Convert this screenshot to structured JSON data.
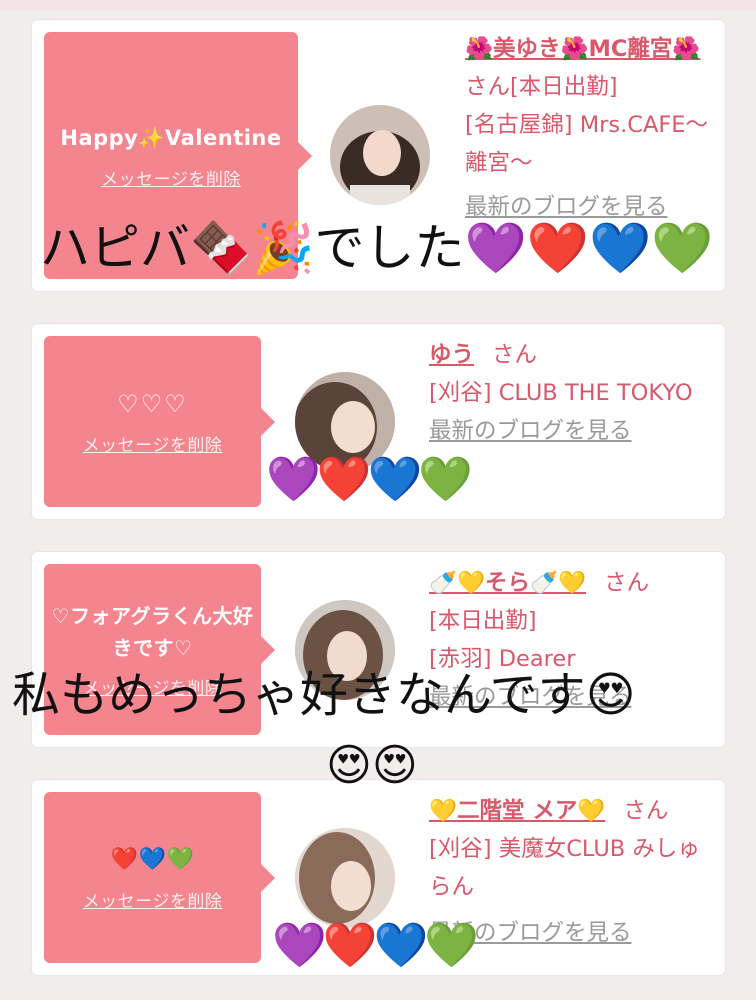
{
  "cards": [
    {
      "message": "Happy✨Valentine",
      "delete_label": "メッセージを削除",
      "name": "🌺美ゆき🌺MC離宮🌺",
      "san": "さん",
      "status": "[本日出勤]",
      "shop": "[名古屋錦] Mrs.CAFE〜離宮〜",
      "blog_label": "最新のブログを見る"
    },
    {
      "message": "♡♡♡",
      "delete_label": "メッセージを削除",
      "name": "ゆう",
      "san": "さん",
      "shop": "[刈谷] CLUB THE TOKYO",
      "blog_label": "最新のブログを見る"
    },
    {
      "message": "♡フォアグラくん大好きです♡",
      "delete_label": "メッセージを削除",
      "name": "🍼💛そら🍼💛",
      "san": "さん",
      "status": "[本日出勤]",
      "shop": "[赤羽] Dearer",
      "blog_label": "最新のブログを見る"
    },
    {
      "message": "❤️💙💚",
      "delete_label": "メッセージを削除",
      "name": "💛二階堂 メア💛",
      "san": "さん",
      "shop": "[刈谷] 美魔女CLUB みしゅらん",
      "blog_label": "最新のブログを見る"
    }
  ],
  "overlays": {
    "caption1": "ハピバ🍫🎉でした💜❤️💙💚",
    "hearts2": "💜❤️💙💚",
    "caption3": "私もめっちゃ好きなんです😍",
    "caption3b": "😍😍",
    "hearts4": "💜❤️💙💚"
  },
  "colors": {
    "accent_pink": "#f4858f",
    "name_pink": "#d9596b"
  }
}
